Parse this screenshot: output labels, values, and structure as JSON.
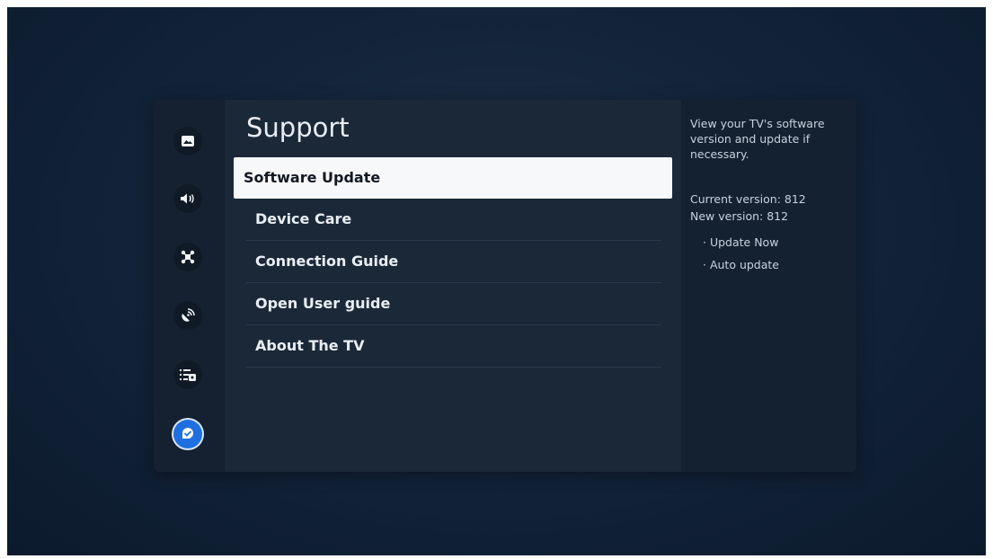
{
  "screen": {
    "title": "Support",
    "rail_icons": [
      {
        "name": "picture-icon",
        "active": false
      },
      {
        "name": "sound-icon",
        "active": false
      },
      {
        "name": "connection-icon",
        "active": false
      },
      {
        "name": "broadcasting-icon",
        "active": false
      },
      {
        "name": "general-privacy-icon",
        "active": false
      },
      {
        "name": "support-icon",
        "active": true
      }
    ],
    "accent_color": "#1f6fe0"
  },
  "menu": {
    "items": [
      {
        "label": "Software Update",
        "selected": true
      },
      {
        "label": "Device Care",
        "selected": false
      },
      {
        "label": "Connection Guide",
        "selected": false
      },
      {
        "label": "Open User guide",
        "selected": false
      },
      {
        "label": "About The TV",
        "selected": false
      }
    ]
  },
  "info": {
    "description": "View your TV's software version and update if necessary.",
    "current_version": "Current version: 812",
    "new_version": "New version: 812",
    "options": [
      "· Update Now",
      "· Auto update"
    ]
  }
}
